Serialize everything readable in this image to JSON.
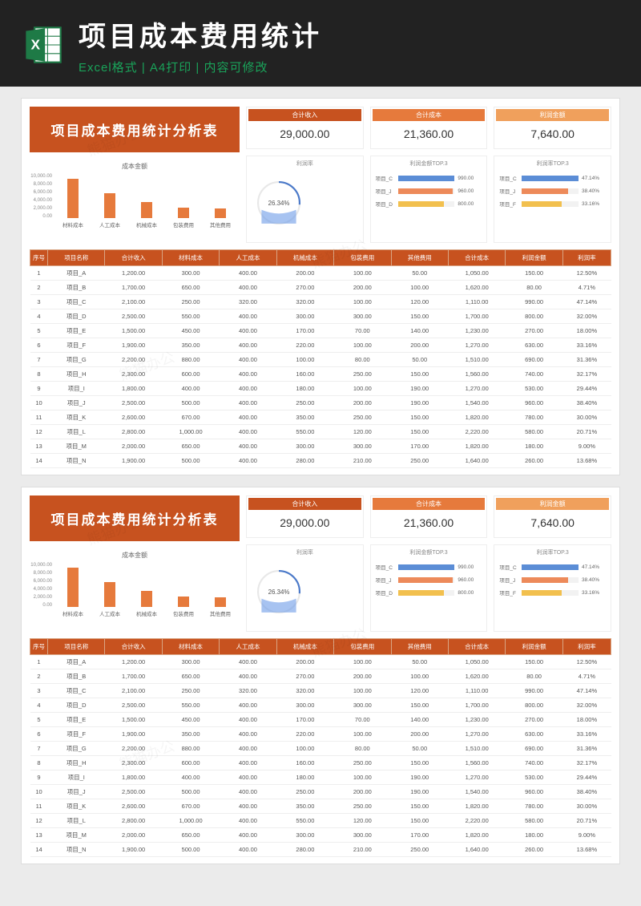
{
  "header": {
    "title": "项目成本费用统计",
    "subtitle": "Excel格式 | A4打印 | 内容可修改"
  },
  "colors": {
    "brand": "#c7521f",
    "kpi1": "#c7521f",
    "kpi2": "#e67a3c",
    "kpi3": "#f0a05c",
    "donut_ring": "#4a79c9",
    "donut_fill": "#6d9be8",
    "bar1": "#5b8dd6",
    "bar2": "#ed8a5a",
    "bar3": "#f2c04e"
  },
  "sheet": {
    "title": "项目成本费用统计分析表",
    "kpis": [
      {
        "label": "合计收入",
        "value": "29,000.00"
      },
      {
        "label": "合计成本",
        "value": "21,360.00"
      },
      {
        "label": "利润金额",
        "value": "7,640.00"
      }
    ],
    "donut": {
      "label": "利润率",
      "pct": "26.34%",
      "value": 26.34
    },
    "top_profit": {
      "title": "利润金额TOP.3",
      "rows": [
        {
          "name": "项目_C",
          "val": "990.00",
          "pct": 100
        },
        {
          "name": "项目_J",
          "val": "960.00",
          "pct": 97
        },
        {
          "name": "项目_D",
          "val": "800.00",
          "pct": 81
        }
      ]
    },
    "top_rate": {
      "title": "利润率TOP.3",
      "rows": [
        {
          "name": "项目_C",
          "val": "47.14%",
          "pct": 100
        },
        {
          "name": "项目_J",
          "val": "38.40%",
          "pct": 81
        },
        {
          "name": "项目_F",
          "val": "33.16%",
          "pct": 70
        }
      ]
    },
    "columns": [
      "序号",
      "项目名称",
      "合计收入",
      "材料成本",
      "人工成本",
      "机械成本",
      "包装费用",
      "其他费用",
      "合计成本",
      "利润金额",
      "利润率"
    ],
    "rows": [
      [
        "1",
        "项目_A",
        "1,200.00",
        "300.00",
        "400.00",
        "200.00",
        "100.00",
        "50.00",
        "1,050.00",
        "150.00",
        "12.50%"
      ],
      [
        "2",
        "项目_B",
        "1,700.00",
        "650.00",
        "400.00",
        "270.00",
        "200.00",
        "100.00",
        "1,620.00",
        "80.00",
        "4.71%"
      ],
      [
        "3",
        "项目_C",
        "2,100.00",
        "250.00",
        "320.00",
        "320.00",
        "100.00",
        "120.00",
        "1,110.00",
        "990.00",
        "47.14%"
      ],
      [
        "4",
        "项目_D",
        "2,500.00",
        "550.00",
        "400.00",
        "300.00",
        "300.00",
        "150.00",
        "1,700.00",
        "800.00",
        "32.00%"
      ],
      [
        "5",
        "项目_E",
        "1,500.00",
        "450.00",
        "400.00",
        "170.00",
        "70.00",
        "140.00",
        "1,230.00",
        "270.00",
        "18.00%"
      ],
      [
        "6",
        "项目_F",
        "1,900.00",
        "350.00",
        "400.00",
        "220.00",
        "100.00",
        "200.00",
        "1,270.00",
        "630.00",
        "33.16%"
      ],
      [
        "7",
        "项目_G",
        "2,200.00",
        "880.00",
        "400.00",
        "100.00",
        "80.00",
        "50.00",
        "1,510.00",
        "690.00",
        "31.36%"
      ],
      [
        "8",
        "项目_H",
        "2,300.00",
        "600.00",
        "400.00",
        "160.00",
        "250.00",
        "150.00",
        "1,560.00",
        "740.00",
        "32.17%"
      ],
      [
        "9",
        "项目_I",
        "1,800.00",
        "400.00",
        "400.00",
        "180.00",
        "100.00",
        "190.00",
        "1,270.00",
        "530.00",
        "29.44%"
      ],
      [
        "10",
        "项目_J",
        "2,500.00",
        "500.00",
        "400.00",
        "250.00",
        "200.00",
        "190.00",
        "1,540.00",
        "960.00",
        "38.40%"
      ],
      [
        "11",
        "项目_K",
        "2,600.00",
        "670.00",
        "400.00",
        "350.00",
        "250.00",
        "150.00",
        "1,820.00",
        "780.00",
        "30.00%"
      ],
      [
        "12",
        "项目_L",
        "2,800.00",
        "1,000.00",
        "400.00",
        "550.00",
        "120.00",
        "150.00",
        "2,220.00",
        "580.00",
        "20.71%"
      ],
      [
        "13",
        "项目_M",
        "2,000.00",
        "650.00",
        "400.00",
        "300.00",
        "300.00",
        "170.00",
        "1,820.00",
        "180.00",
        "9.00%"
      ],
      [
        "14",
        "项目_N",
        "1,900.00",
        "500.00",
        "400.00",
        "280.00",
        "210.00",
        "250.00",
        "1,640.00",
        "260.00",
        "13.68%"
      ]
    ]
  },
  "chart_data": {
    "type": "bar",
    "title": "成本金额",
    "categories": [
      "材料成本",
      "人工成本",
      "机械成本",
      "包装费用",
      "其他费用"
    ],
    "values": [
      8750,
      5520,
      3650,
      2380,
      2060
    ],
    "ylim": [
      0,
      10000
    ],
    "yticks": [
      "10,000.00",
      "8,000.00",
      "6,000.00",
      "4,000.00",
      "2,000.00",
      "0.00"
    ]
  }
}
